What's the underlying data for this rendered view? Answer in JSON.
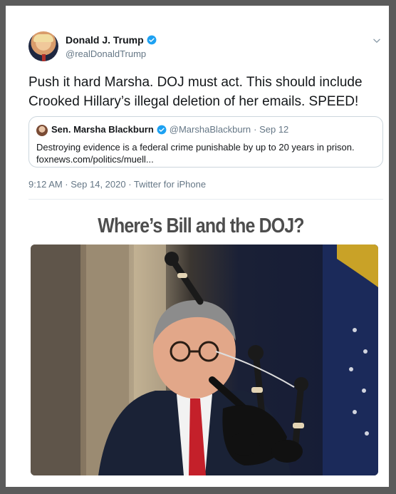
{
  "tweet": {
    "display_name": "Donald J. Trump",
    "handle": "@realDonaldTrump",
    "text": "Push it hard Marsha. DOJ must act. This should include Crooked Hillary’s illegal deletion of her emails. SPEED!",
    "timestamp": "9:12 AM · Sep 14, 2020 · Twitter for iPhone",
    "verified_color": "#1da1f2"
  },
  "quoted_tweet": {
    "display_name": "Sen. Marsha Blackburn",
    "handle": "@MarshaBlackburn",
    "date": "· Sep 12",
    "text": "Destroying evidence is a federal crime punishable by up to 20 years in prison.",
    "link": "foxnews.com/politics/muell..."
  },
  "caption": "Where’s Bill and the DOJ?",
  "photo_icon": "photo-man-playing-bagpipes",
  "frame_color": "#5b5b5b"
}
